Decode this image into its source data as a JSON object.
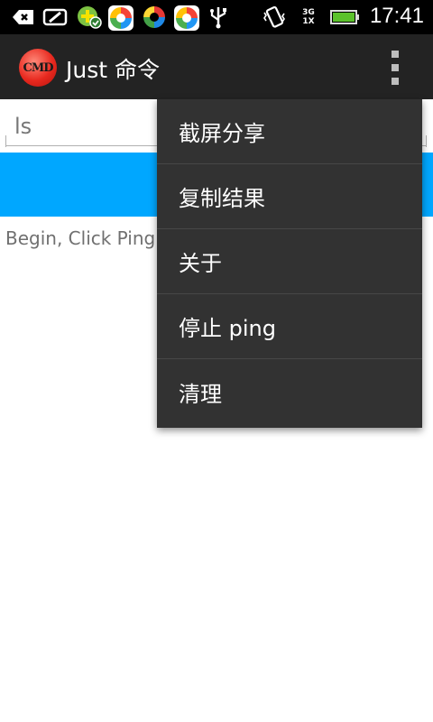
{
  "status_bar": {
    "time": "17:41",
    "network_top": "3G",
    "network_bottom": "1X",
    "icons": [
      "back-arrow-icon",
      "tablet-icon",
      "plus-check-icon",
      "app-store-icon",
      "quad-circle-icon",
      "app-store-icon",
      "usb-icon",
      "vibrate-icon",
      "signal-icon",
      "battery-icon"
    ]
  },
  "action_bar": {
    "logo_text": "CMD",
    "title": "Just 命令"
  },
  "content": {
    "command_value": "ls",
    "output_text": "Begin, Click Ping"
  },
  "menu": {
    "items": [
      {
        "label": "截屏分享"
      },
      {
        "label": "复制结果"
      },
      {
        "label": "关于"
      },
      {
        "label": "停止 ping"
      },
      {
        "label": "清理"
      }
    ]
  },
  "colors": {
    "status_bar": "#000000",
    "action_bar": "#232323",
    "accent_button": "#00a7ff",
    "menu_background": "#323232"
  }
}
